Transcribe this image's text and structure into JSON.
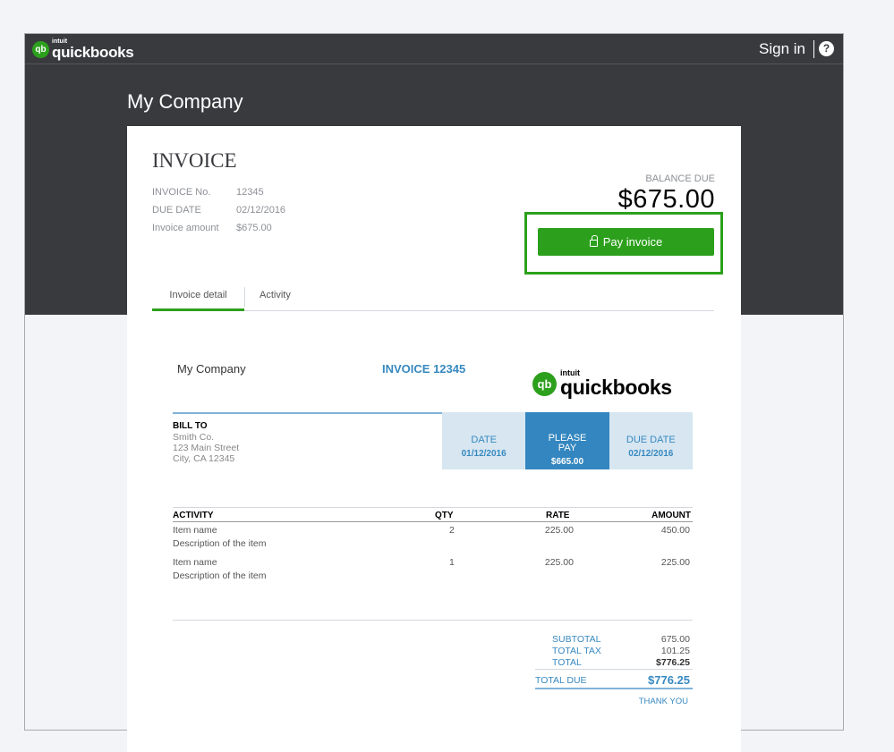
{
  "topbar": {
    "brand_small": "intuit",
    "brand": "quickbooks",
    "signin": "Sign in",
    "help": "?"
  },
  "company_name": "My Company",
  "summary": {
    "title": "INVOICE",
    "invoice_no_label": "INVOICE No.",
    "invoice_no": "12345",
    "due_date_label": "DUE DATE",
    "due_date": "02/12/2016",
    "amount_label": "Invoice amount",
    "amount": "$675.00",
    "balance_label": "BALANCE DUE",
    "balance": "$675.00",
    "pay_button": "Pay invoice"
  },
  "tabs": [
    {
      "label": "Invoice detail",
      "active": true
    },
    {
      "label": "Activity",
      "active": false
    }
  ],
  "doc": {
    "company": "My Company",
    "invoice_title": "INVOICE 12345",
    "logo_small": "intuit",
    "logo": "quickbooks",
    "bill_to_label": "BILL TO",
    "bill_to": [
      "Smith Co.",
      "123 Main Street",
      "City, CA 12345"
    ],
    "date_label": "DATE",
    "date": "01/12/2016",
    "please_pay_label1": "PLEASE",
    "please_pay_label2": "PAY",
    "please_pay": "$665.00",
    "due_date_label": "DUE DATE",
    "due_date": "02/12/2016",
    "columns": [
      "ACTIVITY",
      "QTY",
      "RATE",
      "AMOUNT"
    ],
    "items": [
      {
        "name": "Item name",
        "desc": "Description of the item",
        "qty": "2",
        "rate": "225.00",
        "amount": "450.00"
      },
      {
        "name": "Item name",
        "desc": "Description of the item",
        "qty": "1",
        "rate": "225.00",
        "amount": "225.00"
      }
    ],
    "subtotal_label": "SUBTOTAL",
    "subtotal": "675.00",
    "tax_label": "TOTAL TAX",
    "tax": "101.25",
    "total_label": "TOTAL",
    "total": "$776.25",
    "total_due_label": "TOTAL DUE",
    "total_due": "$776.25",
    "thanks": "THANK YOU"
  },
  "colors": {
    "green": "#2ca01c",
    "blue": "#3386bf",
    "dark": "#393a3e"
  }
}
